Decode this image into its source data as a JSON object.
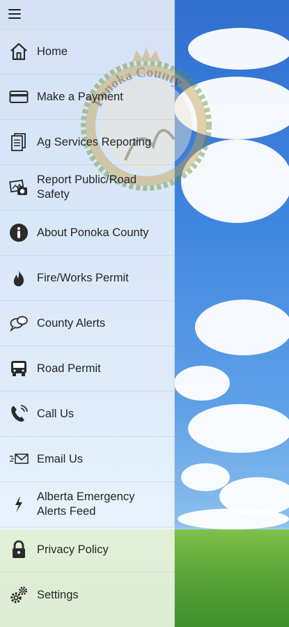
{
  "header": {
    "menu_icon": "hamburger-icon"
  },
  "menu": {
    "items": [
      {
        "label": "Home",
        "icon": "home-icon"
      },
      {
        "label": "Make a Payment",
        "icon": "credit-card-icon"
      },
      {
        "label": "Ag Services Reporting",
        "icon": "document-icon"
      },
      {
        "label": "Report Public/Road Safety",
        "icon": "camera-report-icon"
      },
      {
        "label": "About Ponoka County",
        "icon": "info-icon"
      },
      {
        "label": "Fire/Works Permit",
        "icon": "flame-icon"
      },
      {
        "label": "County Alerts",
        "icon": "chat-bubbles-icon"
      },
      {
        "label": "Road Permit",
        "icon": "truck-icon"
      },
      {
        "label": "Call Us",
        "icon": "phone-icon"
      },
      {
        "label": "Email Us",
        "icon": "envelope-icon"
      },
      {
        "label": "Alberta Emergency Alerts Feed",
        "icon": "lightning-icon"
      },
      {
        "label": "Privacy Policy",
        "icon": "lock-icon"
      },
      {
        "label": "Settings",
        "icon": "gears-icon"
      }
    ]
  },
  "logo": {
    "text": "Ponoka County"
  },
  "colors": {
    "icon": "#2b2b2b",
    "text": "#262626",
    "sky": "#3f86df",
    "grass": "#5ea83a"
  }
}
